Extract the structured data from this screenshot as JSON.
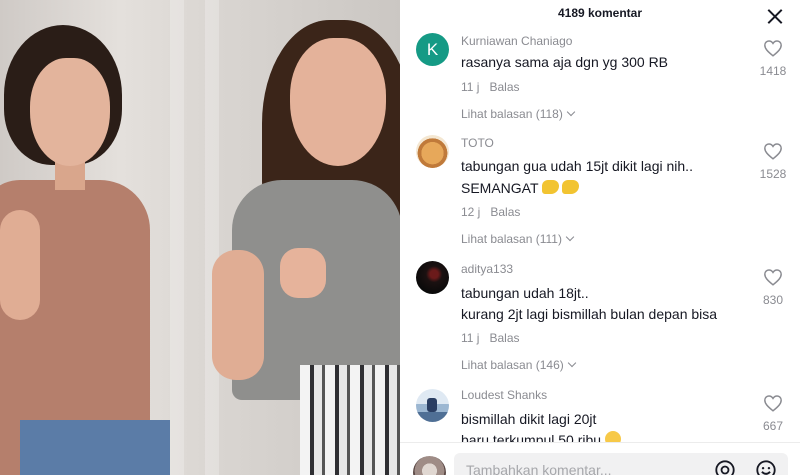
{
  "header": {
    "title": "4189 komentar"
  },
  "comments": [
    {
      "username": "Kurniawan Chaniago",
      "avatar_letter": "K",
      "lines": [
        "rasanya sama aja dgn yg 300 RB"
      ],
      "time": "11 j",
      "reply_label": "Balas",
      "view_replies": "Lihat balasan (118)",
      "likes": "1418"
    },
    {
      "username": "TOTO",
      "lines": [
        "tabungan gua udah 15jt dikit lagi nih..",
        "SEMANGAT"
      ],
      "time": "12 j",
      "reply_label": "Balas",
      "view_replies": "Lihat balasan (111)",
      "likes": "1528"
    },
    {
      "username": "aditya133",
      "lines": [
        "tabungan udah 18jt..",
        "kurang 2jt lagi bismillah bulan depan bisa"
      ],
      "time": "11 j",
      "reply_label": "Balas",
      "view_replies": "Lihat balasan (146)",
      "likes": "830"
    },
    {
      "username": "Loudest Shanks",
      "lines": [
        "bismillah dikit lagi 20jt",
        "baru terkumpul 50 ribu"
      ],
      "likes": "667"
    }
  ],
  "input": {
    "placeholder": "Tambahkan komentar..."
  },
  "icons": {
    "close": "close-icon",
    "like": "heart-outline-icon",
    "mention": "at-sign-icon",
    "emoji": "smiley-icon",
    "expand": "chevron-down-icon"
  },
  "colors": {
    "text": "#161823",
    "muted": "#8a8b91",
    "avatar_k": "#159a85"
  }
}
